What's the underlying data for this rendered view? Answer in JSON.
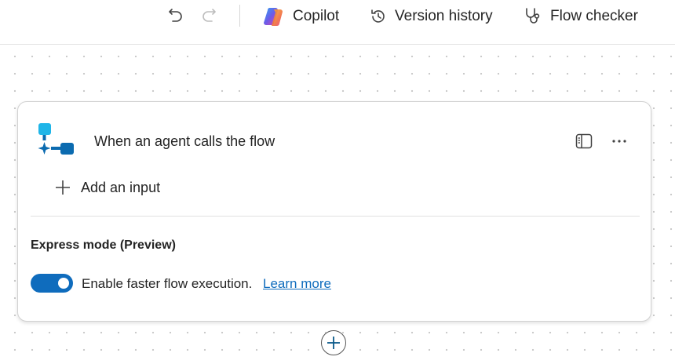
{
  "toolbar": {
    "undo_icon": "undo-icon",
    "redo_icon": "redo-icon",
    "copilot_label": "Copilot",
    "version_history_label": "Version history",
    "flow_checker_label": "Flow checker"
  },
  "trigger_card": {
    "title": "When an agent calls the flow",
    "add_input_label": "Add an input",
    "express_mode_label": "Express mode (Preview)",
    "toggle_on": true,
    "toggle_text": "Enable faster flow execution.",
    "learn_more_label": "Learn more"
  },
  "colors": {
    "accent": "#0f6cbd",
    "trigger_icon": "#1fb5e8",
    "trigger_icon_dark": "#0b6bb0"
  }
}
